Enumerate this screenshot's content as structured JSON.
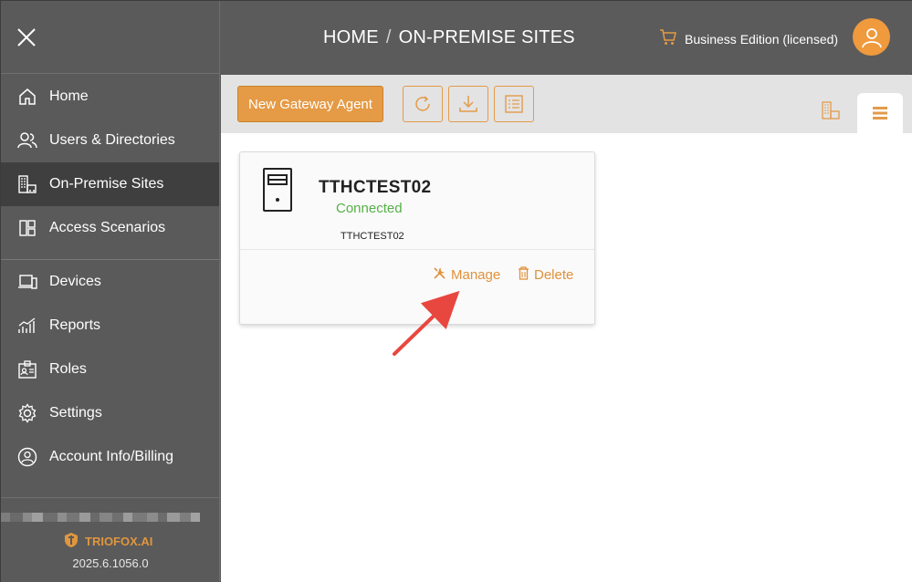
{
  "sidebar": {
    "items_group1": [
      {
        "label": "Home",
        "icon": "home-icon"
      },
      {
        "label": "Users & Directories",
        "icon": "users-icon"
      },
      {
        "label": "On-Premise Sites",
        "icon": "building-icon",
        "active": true
      },
      {
        "label": "Access Scenarios",
        "icon": "layout-icon"
      }
    ],
    "items_group2": [
      {
        "label": "Devices",
        "icon": "devices-icon"
      },
      {
        "label": "Reports",
        "icon": "chart-icon"
      },
      {
        "label": "Roles",
        "icon": "id-card-icon"
      },
      {
        "label": "Settings",
        "icon": "gear-icon"
      },
      {
        "label": "Account Info/Billing",
        "icon": "account-icon"
      }
    ],
    "brand": "TRIOFOX.AI",
    "version": "2025.6.1056.0"
  },
  "header": {
    "crumb_home": "HOME",
    "crumb_sep": "/",
    "crumb_page": "ON-PREMISE SITES",
    "edition": "Business Edition (licensed)"
  },
  "toolbar": {
    "new_agent_label": "New Gateway Agent"
  },
  "site_card": {
    "name": "TTHCTEST02",
    "status": "Connected",
    "host": "TTHCTEST02",
    "manage_label": "Manage",
    "delete_label": "Delete"
  },
  "colors": {
    "accent": "#e59a45",
    "status_ok": "#55b046",
    "arrow": "#e8473f"
  }
}
